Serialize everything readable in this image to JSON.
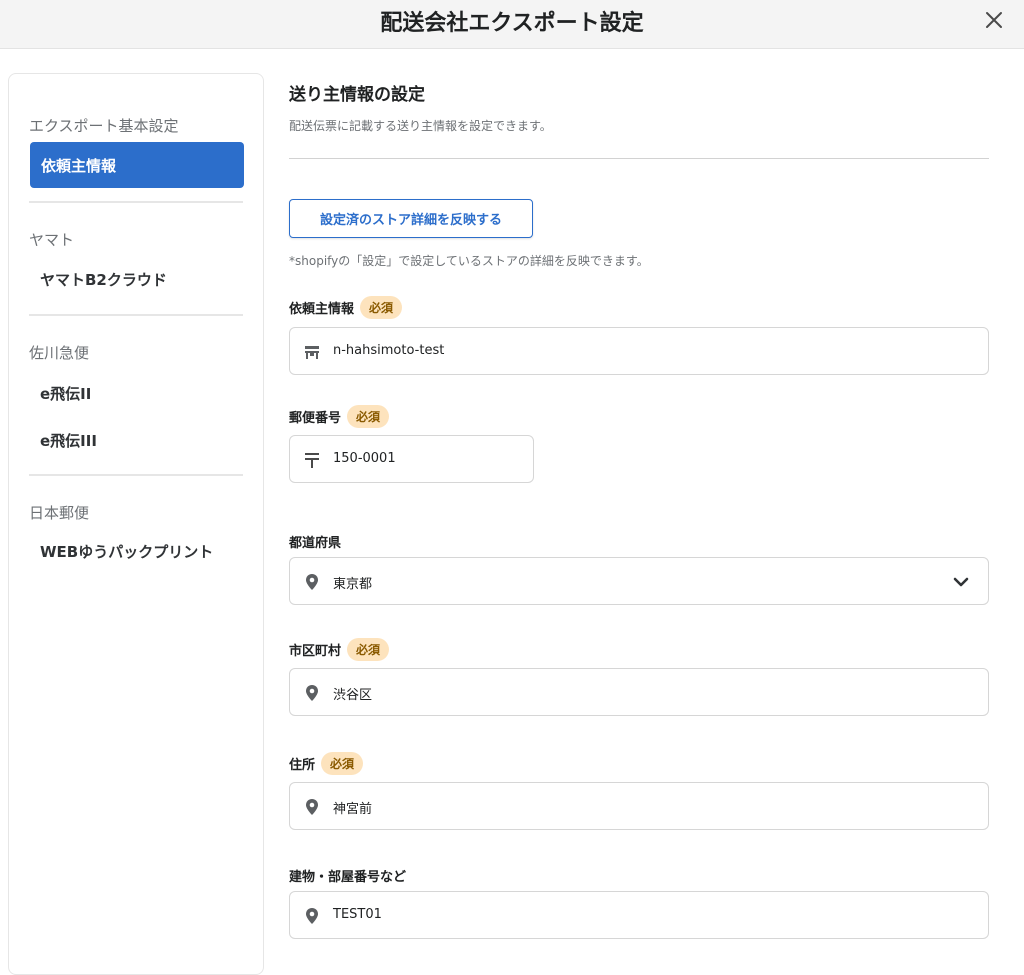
{
  "header": {
    "title": "配送会社エクスポート設定"
  },
  "sidebar": {
    "groups": [
      {
        "heading": "エクスポート基本設定",
        "items": [
          {
            "label": "依頼主情報"
          }
        ]
      },
      {
        "heading": "ヤマト",
        "items": [
          {
            "label": "ヤマトB2クラウド"
          }
        ]
      },
      {
        "heading": "佐川急便",
        "items": [
          {
            "label": "e飛伝II"
          },
          {
            "label": "e飛伝III"
          }
        ]
      },
      {
        "heading": "日本郵便",
        "items": [
          {
            "label": "WEBゆうパックプリント"
          }
        ]
      }
    ]
  },
  "main": {
    "title": "送り主情報の設定",
    "description": "配送伝票に記載する送り主情報を設定できます。",
    "reflect_button": "設定済のストア詳細を反映する",
    "note": "*shopifyの「設定」で設定しているストアの詳細を反映できます。",
    "required_label": "必須",
    "fields": {
      "requester": {
        "label": "依頼主情報",
        "value": "n-hahsimoto-test",
        "icon": "store-icon"
      },
      "postal": {
        "label": "郵便番号",
        "value": "150-0001",
        "icon": "postal-mark-icon"
      },
      "prefecture": {
        "label": "都道府県",
        "value": "東京都",
        "icon": "location-pin-icon"
      },
      "city": {
        "label": "市区町村",
        "value": "渋谷区",
        "icon": "location-pin-icon"
      },
      "address": {
        "label": "住所",
        "value": "神宮前",
        "icon": "location-pin-icon"
      },
      "building": {
        "label": "建物・部屋番号など",
        "value": "TEST01",
        "icon": "location-pin-icon"
      }
    }
  },
  "colors": {
    "accent": "#2c6ecb",
    "required_badge_bg": "#fde3bd",
    "required_badge_text": "#8a5a00"
  }
}
